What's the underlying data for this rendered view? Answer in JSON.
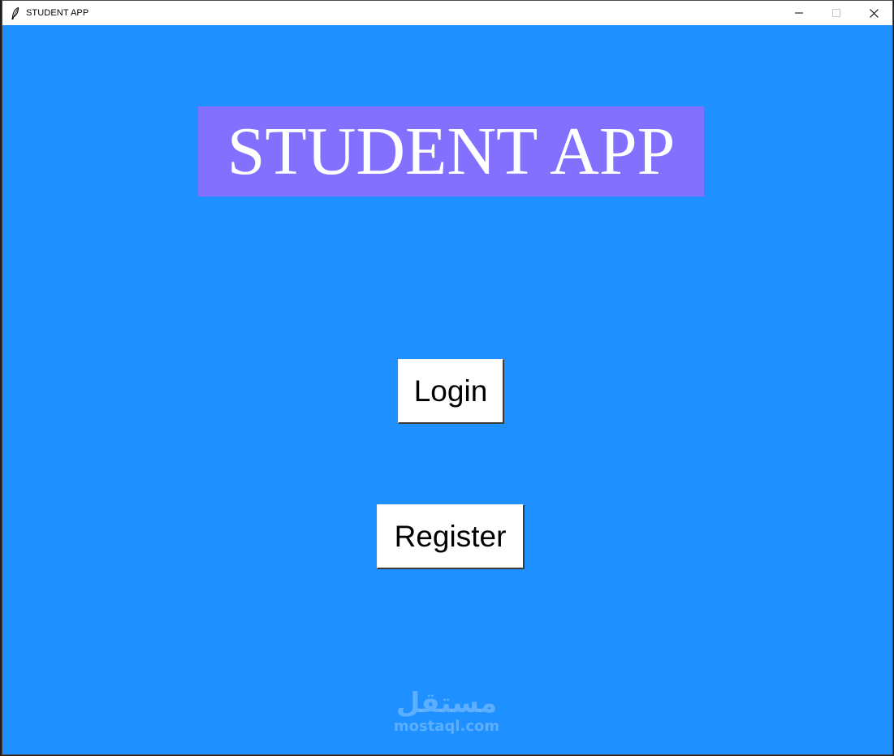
{
  "window": {
    "title": "STUDENT APP",
    "app_icon": "feather-icon",
    "controls": {
      "minimize": "minimize-icon",
      "maximize": "maximize-icon",
      "close": "close-icon"
    }
  },
  "main": {
    "heading": "STUDENT APP",
    "login_label": "Login",
    "register_label": "Register"
  },
  "watermark": {
    "logo_text": "مستقل",
    "site": "mostaql.com"
  },
  "colors": {
    "background": "#1e90ff",
    "heading_bg": "#8470ff",
    "heading_text": "#ffffff",
    "button_bg": "#ffffff"
  }
}
